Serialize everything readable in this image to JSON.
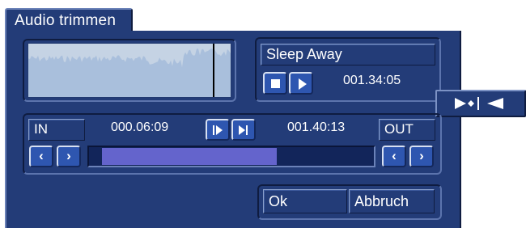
{
  "dialog": {
    "title": "Audio trimmen"
  },
  "player": {
    "song_title": "Sleep Away",
    "position": "001.34:05",
    "stop_icon": "stop-icon",
    "play_icon": "play-icon"
  },
  "waveform": {
    "playhead_fraction": 0.91
  },
  "marker_tab_icon": "set-marker-icon",
  "trim": {
    "in_label": "IN",
    "in_time": "000.06:09",
    "out_label": "OUT",
    "out_time": "001.40:13",
    "step_forward_icon": "step-forward-icon",
    "goto_end_icon": "skip-to-end-icon",
    "back_glyph": "‹",
    "forward_glyph": "›",
    "range_start_fraction": 0.045,
    "range_end_fraction": 0.66
  },
  "actions": {
    "ok_label": "Ok",
    "cancel_label": "Abbruch"
  },
  "colors": {
    "panel": "#233c78",
    "button_face": "#2e56b0",
    "waveform_bg": "#c5d3e4",
    "waveform_signal": "#a9bfdc",
    "range_fill": "#6464cc"
  }
}
